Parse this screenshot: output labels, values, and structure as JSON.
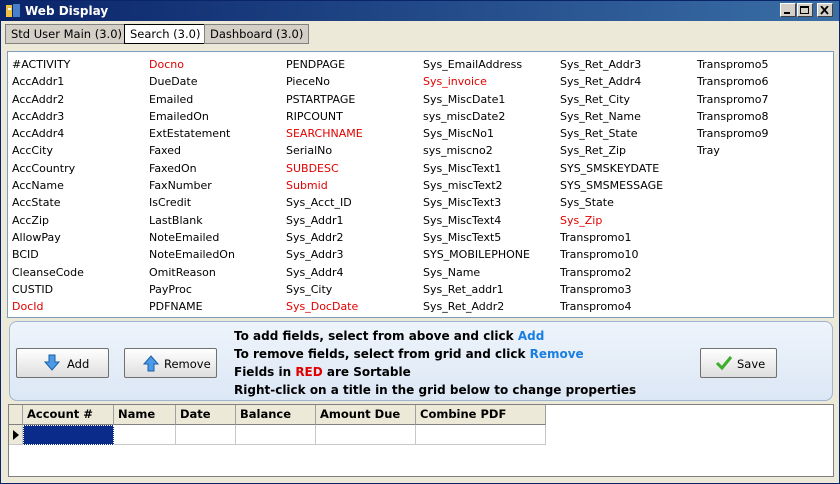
{
  "window": {
    "title": "Web Display"
  },
  "tabs": [
    {
      "label": "Std User Main (3.0)"
    },
    {
      "label": "Search (3.0)"
    },
    {
      "label": "Dashboard (3.0)"
    }
  ],
  "field_columns": [
    [
      {
        "name": "#ACTIVITY",
        "sortable": false
      },
      {
        "name": "AccAddr1",
        "sortable": false
      },
      {
        "name": "AccAddr2",
        "sortable": false
      },
      {
        "name": "AccAddr3",
        "sortable": false
      },
      {
        "name": "AccAddr4",
        "sortable": false
      },
      {
        "name": "AccCity",
        "sortable": false
      },
      {
        "name": "AccCountry",
        "sortable": false
      },
      {
        "name": "AccName",
        "sortable": false
      },
      {
        "name": "AccState",
        "sortable": false
      },
      {
        "name": "AccZip",
        "sortable": false
      },
      {
        "name": "AllowPay",
        "sortable": false
      },
      {
        "name": "BCID",
        "sortable": false
      },
      {
        "name": "CleanseCode",
        "sortable": false
      },
      {
        "name": "CUSTID",
        "sortable": false
      },
      {
        "name": "DocId",
        "sortable": true
      }
    ],
    [
      {
        "name": "Docno",
        "sortable": true
      },
      {
        "name": "DueDate",
        "sortable": false
      },
      {
        "name": "Emailed",
        "sortable": false
      },
      {
        "name": "EmailedOn",
        "sortable": false
      },
      {
        "name": "ExtEstatement",
        "sortable": false
      },
      {
        "name": "Faxed",
        "sortable": false
      },
      {
        "name": "FaxedOn",
        "sortable": false
      },
      {
        "name": "FaxNumber",
        "sortable": false
      },
      {
        "name": "IsCredit",
        "sortable": false
      },
      {
        "name": "LastBlank",
        "sortable": false
      },
      {
        "name": "NoteEmailed",
        "sortable": false
      },
      {
        "name": "NoteEmailedOn",
        "sortable": false
      },
      {
        "name": "OmitReason",
        "sortable": false
      },
      {
        "name": "PayProc",
        "sortable": false
      },
      {
        "name": "PDFNAME",
        "sortable": false
      }
    ],
    [
      {
        "name": "PENDPAGE",
        "sortable": false
      },
      {
        "name": "PieceNo",
        "sortable": false
      },
      {
        "name": "PSTARTPAGE",
        "sortable": false
      },
      {
        "name": "RIPCOUNT",
        "sortable": false
      },
      {
        "name": "SEARCHNAME",
        "sortable": true
      },
      {
        "name": "SerialNo",
        "sortable": false
      },
      {
        "name": "SUBDESC",
        "sortable": true
      },
      {
        "name": "Submid",
        "sortable": true
      },
      {
        "name": "Sys_Acct_ID",
        "sortable": false
      },
      {
        "name": "Sys_Addr1",
        "sortable": false
      },
      {
        "name": "Sys_Addr2",
        "sortable": false
      },
      {
        "name": "Sys_Addr3",
        "sortable": false
      },
      {
        "name": "Sys_Addr4",
        "sortable": false
      },
      {
        "name": "Sys_City",
        "sortable": false
      },
      {
        "name": "Sys_DocDate",
        "sortable": true
      }
    ],
    [
      {
        "name": "Sys_EmailAddress",
        "sortable": false
      },
      {
        "name": "Sys_invoice",
        "sortable": true
      },
      {
        "name": "Sys_MiscDate1",
        "sortable": false
      },
      {
        "name": "sys_miscDate2",
        "sortable": false
      },
      {
        "name": "Sys_MiscNo1",
        "sortable": false
      },
      {
        "name": "sys_miscno2",
        "sortable": false
      },
      {
        "name": "Sys_MiscText1",
        "sortable": false
      },
      {
        "name": "Sys_miscText2",
        "sortable": false
      },
      {
        "name": "Sys_MiscText3",
        "sortable": false
      },
      {
        "name": "Sys_MiscText4",
        "sortable": false
      },
      {
        "name": "Sys_MiscText5",
        "sortable": false
      },
      {
        "name": "SYS_MOBILEPHONE",
        "sortable": false
      },
      {
        "name": "Sys_Name",
        "sortable": false
      },
      {
        "name": "Sys_Ret_addr1",
        "sortable": false
      },
      {
        "name": "Sys_Ret_Addr2",
        "sortable": false
      }
    ],
    [
      {
        "name": "Sys_Ret_Addr3",
        "sortable": false
      },
      {
        "name": "Sys_Ret_Addr4",
        "sortable": false
      },
      {
        "name": "Sys_Ret_City",
        "sortable": false
      },
      {
        "name": "Sys_Ret_Name",
        "sortable": false
      },
      {
        "name": "Sys_Ret_State",
        "sortable": false
      },
      {
        "name": "Sys_Ret_Zip",
        "sortable": false
      },
      {
        "name": "SYS_SMSKEYDATE",
        "sortable": false
      },
      {
        "name": "SYS_SMSMESSAGE",
        "sortable": false
      },
      {
        "name": "Sys_State",
        "sortable": false
      },
      {
        "name": "Sys_Zip",
        "sortable": true
      },
      {
        "name": "Transpromo1",
        "sortable": false
      },
      {
        "name": "Transpromo10",
        "sortable": false
      },
      {
        "name": "Transpromo2",
        "sortable": false
      },
      {
        "name": "Transpromo3",
        "sortable": false
      },
      {
        "name": "Transpromo4",
        "sortable": false
      }
    ],
    [
      {
        "name": "Transpromo5",
        "sortable": false
      },
      {
        "name": "Transpromo6",
        "sortable": false
      },
      {
        "name": "Transpromo7",
        "sortable": false
      },
      {
        "name": "Transpromo8",
        "sortable": false
      },
      {
        "name": "Transpromo9",
        "sortable": false
      },
      {
        "name": "Tray",
        "sortable": false
      }
    ]
  ],
  "buttons": {
    "add": "Add",
    "remove": "Remove",
    "save": "Save"
  },
  "instructions": {
    "line1_prefix": "To add fields, select from above and click ",
    "line1_keyword": "Add",
    "line2_prefix": "To remove fields, select from grid and  click ",
    "line2_keyword": "Remove",
    "line3_prefix": "Fields in ",
    "line3_keyword": "RED",
    "line3_suffix": " are Sortable",
    "line4": "Right-click on a title in the grid below to change properties"
  },
  "grid": {
    "columns": [
      "Account #",
      "Name",
      "Date",
      "Balance",
      "Amount Due",
      "Combine PDF"
    ]
  },
  "colors": {
    "sortable": "#e00000",
    "keyword_blue": "#1a7fe0",
    "title_bar": "#0a246a"
  },
  "icons": {
    "add": "arrow-down-icon",
    "remove": "arrow-up-icon",
    "save": "checkmark-icon"
  }
}
